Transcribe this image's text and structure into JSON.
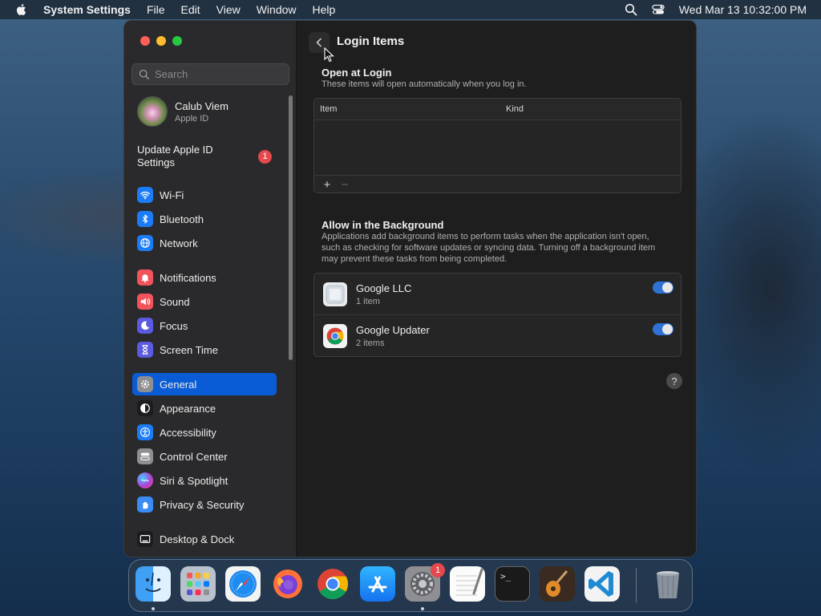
{
  "menubar": {
    "app_name": "System Settings",
    "menus": [
      "File",
      "Edit",
      "View",
      "Window",
      "Help"
    ],
    "clock": "Wed Mar 13  10:32:00 PM"
  },
  "sidebar": {
    "search_placeholder": "Search",
    "profile": {
      "name": "Calub Viem",
      "subtitle": "Apple ID"
    },
    "update": {
      "label": "Update Apple ID Settings",
      "badge": "1"
    },
    "items": [
      {
        "label": "Wi-Fi",
        "icon": "wifi-icon",
        "color": "#1b7cf5"
      },
      {
        "label": "Bluetooth",
        "icon": "bluetooth-icon",
        "color": "#1b7cf5"
      },
      {
        "label": "Network",
        "icon": "globe-icon",
        "color": "#1b7cf5"
      },
      {
        "label": "Notifications",
        "icon": "bell-icon",
        "color": "#f2545b"
      },
      {
        "label": "Sound",
        "icon": "speaker-icon",
        "color": "#f2545b"
      },
      {
        "label": "Focus",
        "icon": "moon-icon",
        "color": "#5b5ae0"
      },
      {
        "label": "Screen Time",
        "icon": "hourglass-icon",
        "color": "#5b5ae0"
      },
      {
        "label": "General",
        "icon": "gear-icon",
        "color": "#8e8e93",
        "selected": true
      },
      {
        "label": "Appearance",
        "icon": "appearance-icon",
        "color": "#1c1c1e"
      },
      {
        "label": "Accessibility",
        "icon": "accessibility-icon",
        "color": "#1b7cf5"
      },
      {
        "label": "Control Center",
        "icon": "control-center-icon",
        "color": "#8e8e93"
      },
      {
        "label": "Siri & Spotlight",
        "icon": "siri-icon",
        "color": "#b03fd6"
      },
      {
        "label": "Privacy & Security",
        "icon": "hand-icon",
        "color": "#3a8bf6"
      },
      {
        "label": "Desktop & Dock",
        "icon": "dock-icon",
        "color": "#1c1c1e"
      }
    ]
  },
  "content": {
    "title": "Login Items",
    "open_at_login": {
      "title": "Open at Login",
      "description": "These items will open automatically when you log in.",
      "columns": [
        "Item",
        "Kind"
      ],
      "add_label": "+",
      "remove_label": "−"
    },
    "background": {
      "title": "Allow in the Background",
      "description": "Applications add background items to perform tasks when the application isn't open, such as checking for software updates or syncing data. Turning off a background item may prevent these tasks from being completed.",
      "items": [
        {
          "name": "Google LLC",
          "subtitle": "1 item",
          "enabled": true
        },
        {
          "name": "Google Updater",
          "subtitle": "2 items",
          "enabled": true
        }
      ]
    },
    "help_label": "?"
  },
  "dock": {
    "items": [
      {
        "name": "Finder",
        "icon": "finder-icon"
      },
      {
        "name": "Launchpad",
        "icon": "launchpad-icon"
      },
      {
        "name": "Safari",
        "icon": "safari-icon"
      },
      {
        "name": "Firefox",
        "icon": "firefox-icon"
      },
      {
        "name": "Google Chrome",
        "icon": "chrome-icon"
      },
      {
        "name": "App Store",
        "icon": "app-store-icon"
      },
      {
        "name": "System Settings",
        "icon": "system-settings-icon",
        "badge": "1"
      },
      {
        "name": "TextEdit",
        "icon": "textedit-icon"
      },
      {
        "name": "Terminal",
        "icon": "terminal-icon",
        "label": ">_"
      },
      {
        "name": "GarageBand",
        "icon": "guitar-icon"
      },
      {
        "name": "Visual Studio Code",
        "icon": "vscode-icon"
      },
      {
        "name": "Trash",
        "icon": "trash-icon"
      }
    ]
  }
}
